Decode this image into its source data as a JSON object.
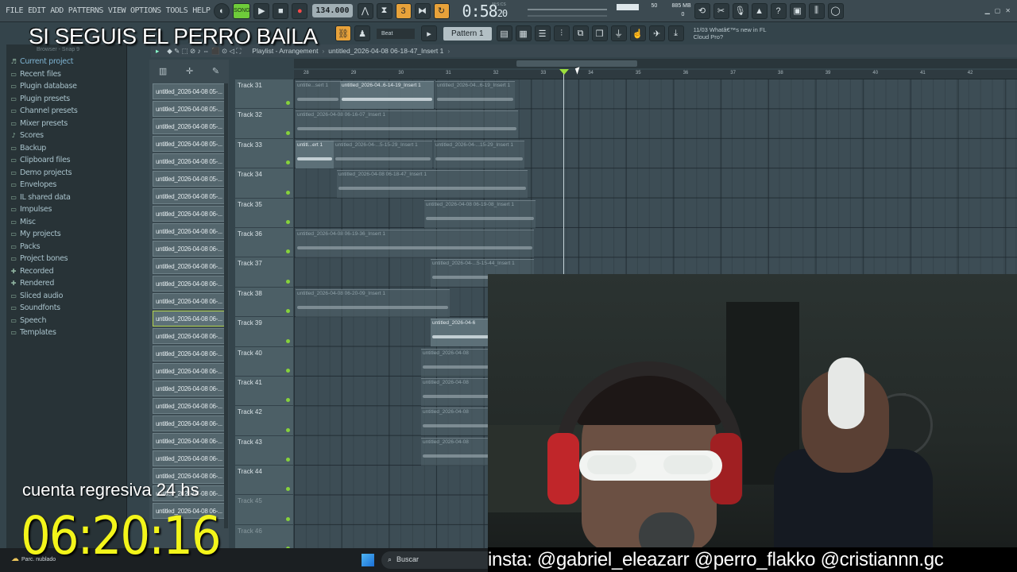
{
  "menu": [
    "FILE",
    "EDIT",
    "ADD",
    "PATTERNS",
    "VIEW",
    "OPTIONS",
    "TOOLS",
    "HELP"
  ],
  "transport": {
    "song_label": "SONG",
    "tempo": "134.000",
    "time": "0:58",
    "time_sub": "20",
    "time_mode": "M:S:CS",
    "cpu": "50",
    "mem": "885 MB",
    "voices": "0"
  },
  "overlay_title": "SI SEGUIS EL PERRO BAILA",
  "toolbar2": {
    "snap": "Beat",
    "pattern": "Pattern 1",
    "news_line1": "11/03  Whatâ€™s new in FL",
    "news_line2": "Cloud Pro?"
  },
  "browser": {
    "header": "Browser - Snap 9",
    "items": [
      {
        "label": "Current project",
        "icon": "current-project-icon"
      },
      {
        "label": "Recent files",
        "icon": "folder-icon"
      },
      {
        "label": "Plugin database",
        "icon": "folder-icon"
      },
      {
        "label": "Plugin presets",
        "icon": "folder-icon"
      },
      {
        "label": "Channel presets",
        "icon": "folder-icon"
      },
      {
        "label": "Mixer presets",
        "icon": "folder-icon"
      },
      {
        "label": "Scores",
        "icon": "note-icon"
      },
      {
        "label": "Backup",
        "icon": "folder-icon"
      },
      {
        "label": "Clipboard files",
        "icon": "folder-icon"
      },
      {
        "label": "Demo projects",
        "icon": "folder-icon"
      },
      {
        "label": "Envelopes",
        "icon": "folder-icon"
      },
      {
        "label": "IL shared data",
        "icon": "folder-icon"
      },
      {
        "label": "Impulses",
        "icon": "folder-icon"
      },
      {
        "label": "Misc",
        "icon": "folder-icon"
      },
      {
        "label": "My projects",
        "icon": "folder-icon"
      },
      {
        "label": "Packs",
        "icon": "folder-icon"
      },
      {
        "label": "Project bones",
        "icon": "folder-icon"
      },
      {
        "label": "Recorded",
        "icon": "plus-icon"
      },
      {
        "label": "Rendered",
        "icon": "plus-icon"
      },
      {
        "label": "Sliced audio",
        "icon": "folder-icon"
      },
      {
        "label": "Soundfonts",
        "icon": "folder-icon"
      },
      {
        "label": "Speech",
        "icon": "folder-icon"
      },
      {
        "label": "Templates",
        "icon": "folder-icon"
      }
    ]
  },
  "playlist": {
    "title": "Playlist - Arrangement",
    "file": "untitled_2026-04-08 06-18-47_Insert 1",
    "ruler": [
      "28",
      "29",
      "30",
      "31",
      "32",
      "33",
      "34",
      "35",
      "36",
      "37",
      "38",
      "39",
      "40",
      "41",
      "42"
    ],
    "tracks": [
      "Track 31",
      "Track 32",
      "Track 33",
      "Track 34",
      "Track 35",
      "Track 36",
      "Track 37",
      "Track 38",
      "Track 39",
      "Track 40",
      "Track 41",
      "Track 42",
      "Track 43",
      "Track 44",
      "Track 45",
      "Track 46"
    ],
    "clip_names": {
      "c1": "untitle...sert 1",
      "c2": "untitled_2026-04..6-14-19_Insert 1",
      "c3": "untitled_2026-04...6-19_Insert 1",
      "c4": "untitled_2026-04-08 06-16-07_Insert 1",
      "c5": "untitl...ert 1",
      "c6": "untitled_2026-04-...5-15-29_Insert 1",
      "c7": "untitled_2026-04-...15-29_Insert 1",
      "c8": "untitled_2026-04-08 06-18-47_Insert 1",
      "c9": "untitled_2026-04-08 06-19-08_Insert 1",
      "c10": "untitled_2026-04-08 06-19-36_Insert 1",
      "c11": "untitled_2026-04-...5-15-44_Insert 1",
      "c12": "untitled_2026-04-08 06-20-09_Insert 1",
      "c13": "untitled_2026-04-6",
      "c14": "untitled_2026-04-08",
      "c15": "untitled_2026-04-08",
      "c16": "untitled_2026-04-08",
      "c17": "untitled_2026-04-08"
    }
  },
  "clip_list": [
    "untitled_2026-04-08 05-...",
    "untitled_2026-04-08 05-...",
    "untitled_2026-04-08 05-...",
    "untitled_2026-04-08 05-...",
    "untitled_2026-04-08 05-...",
    "untitled_2026-04-08 05-...",
    "untitled_2026-04-08 05-...",
    "untitled_2026-04-08 06-...",
    "untitled_2026-04-08 06-...",
    "untitled_2026-04-08 06-...",
    "untitled_2026-04-08 06-...",
    "untitled_2026-04-08 06-...",
    "untitled_2026-04-08 06-...",
    "untitled_2026-04-08 06-...",
    "untitled_2026-04-08 06-...",
    "untitled_2026-04-08 06-...",
    "untitled_2026-04-08 06-...",
    "untitled_2026-04-08 06-...",
    "untitled_2026-04-08 06-...",
    "untitled_2026-04-08 06-...",
    "untitled_2026-04-08 06-...",
    "untitled_2026-04-08 06-...",
    "untitled_2026-04-08 06-...",
    "untitled_2026-04-08 06-...",
    "untitled_2026-04-08 06-..."
  ],
  "selected_clip_index": 13,
  "countdown": {
    "label": "cuenta regresiva 24 hs",
    "time": "06:20:16"
  },
  "social": "insta: @gabriel_eleazarr @perro_flakko @cristiannn.gc",
  "taskbar": {
    "weather": "Parc. nublado",
    "search": "Buscar"
  },
  "colors": {
    "accent_green": "#86d23b",
    "countdown_yellow": "#f3f51a",
    "orange": "#e8a23a"
  }
}
